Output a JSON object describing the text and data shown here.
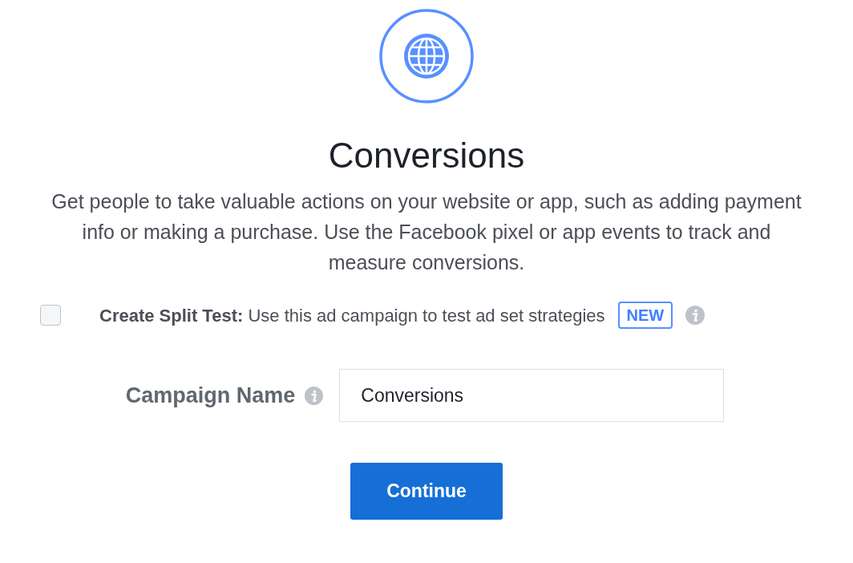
{
  "objective": {
    "title": "Conversions",
    "description": "Get people to take valuable actions on your website or app, such as adding payment info or making a purchase. Use the Facebook pixel or app events to track and measure conversions."
  },
  "split_test": {
    "checked": false,
    "text": "**Create Split Test:** Use this ad campaign to test ad set strategies",
    "badge": "NEW"
  },
  "campaign_name": {
    "label": "Campaign Name",
    "value": "Conversions"
  },
  "buttons": [
    "Continue"
  ]
}
